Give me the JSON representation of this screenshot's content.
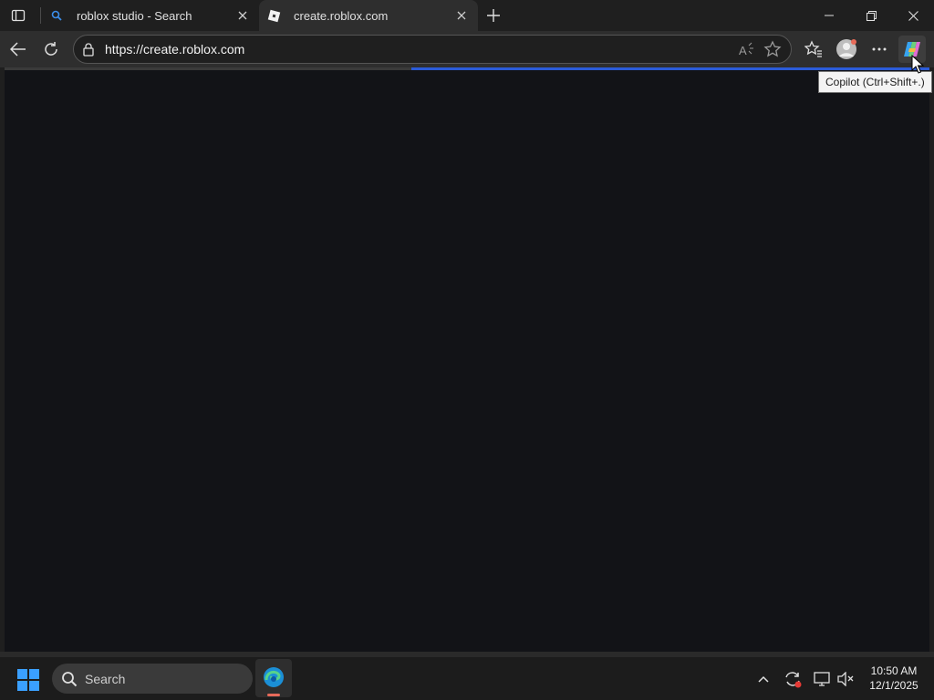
{
  "browser": {
    "tabs": [
      {
        "title": "roblox studio - Search",
        "favicon": "search-icon"
      },
      {
        "title": "create.roblox.com",
        "favicon": "roblox-icon",
        "active": true
      }
    ],
    "address_bar": {
      "url": "https://create.roblox.com"
    },
    "page_loading": true,
    "accent_color": "#2b5bd8"
  },
  "tooltip": {
    "text": "Copilot (Ctrl+Shift+.)"
  },
  "taskbar": {
    "search_placeholder": "Search",
    "clock": {
      "time": "10:50 AM",
      "date": "12/1/2025"
    }
  }
}
